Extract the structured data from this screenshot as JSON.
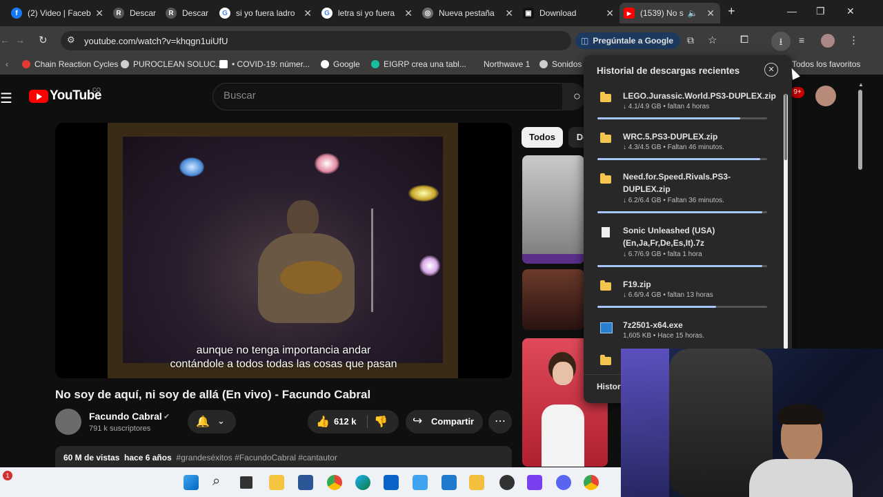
{
  "browser": {
    "tabs": [
      {
        "title": "(2) Video | Faceb",
        "color": "#1877f2",
        "glyph": "f"
      },
      {
        "title": "Descar",
        "color": "#3c3c3c",
        "glyph": "R"
      },
      {
        "title": "Descar",
        "color": "#3c3c3c",
        "glyph": "R"
      },
      {
        "title": "si yo fuera ladro",
        "color": "#ffffff",
        "glyph": "G"
      },
      {
        "title": "letra si yo fuera",
        "color": "#ffffff",
        "glyph": "G"
      },
      {
        "title": "Nueva pestaña",
        "color": "#6e6e6e",
        "glyph": "◎"
      },
      {
        "title": "Download",
        "color": "#2b2b2b",
        "glyph": "▣"
      },
      {
        "title": "(1539) No s",
        "color": "#ff0000",
        "glyph": "▶"
      }
    ],
    "new_tab_glyph": "+",
    "window_controls": [
      "—",
      "❐",
      "✕"
    ],
    "url": "youtube.com/watch?v=khqgn1uiUfU",
    "ask_google": "Pregúntale a Google",
    "bookmarks": [
      {
        "label": "Chain Reaction Cycles",
        "color": "#e53935"
      },
      {
        "label": "PUROCLEAN SOLUC...",
        "color": "#cfcfcf"
      },
      {
        "label": "• COVID-19: númer...",
        "color": "#ffffff"
      },
      {
        "label": "Google",
        "color": "#ffffff"
      },
      {
        "label": "EIGRP crea una tabl...",
        "color": "#1abc9c"
      },
      {
        "label": "Northwave 1",
        "color": "#cfcfcf"
      },
      {
        "label": "Sonidos",
        "color": "#cfcfcf"
      }
    ],
    "all_bookmarks": "Todos los favoritos"
  },
  "youtube": {
    "logo_text": "YouTube",
    "country": "CO",
    "search_placeholder": "Buscar",
    "notif_badge": "9+",
    "subtitle_line1": "aunque no tenga importancia andar",
    "subtitle_line2": "contándole a todos todas las cosas que pasan",
    "video_title": "No soy de aquí, ni soy de allá (En vivo) - Facundo Cabral",
    "channel": "Facundo Cabral",
    "subscribers": "791 k suscriptores",
    "likes": "612 k",
    "share": "Compartir",
    "views": "60 M de vistas",
    "date": "hace 6 años",
    "hashtags": "#grandeséxitos #FacundoCabral #cantautor",
    "chips": [
      "Todos",
      "De"
    ]
  },
  "downloads": {
    "title": "Historial de descargas recientes",
    "footer": "Histor",
    "items": [
      {
        "name": "LEGO.Jurassic.World.PS3-DUPLEX.zip",
        "status": "↓ 4.1/4.9 GB • faltan 4 horas",
        "icon": "folder",
        "progress": 0.84
      },
      {
        "name": "WRC.5.PS3-DUPLEX.zip",
        "status": "↓ 4.3/4.5 GB • Faltan 46 minutos.",
        "icon": "folder",
        "progress": 0.96
      },
      {
        "name": "Need.for.Speed.Rivals.PS3-DUPLEX.zip",
        "status": "↓ 6.2/6.4 GB • Faltan 36 minutos.",
        "icon": "folder",
        "progress": 0.97
      },
      {
        "name": "Sonic Unleashed (USA) (En,Ja,Fr,De,Es,It).7z",
        "status": "↓ 6.7/6.9 GB • falta 1 hora",
        "icon": "file",
        "progress": 0.97
      },
      {
        "name": "F19.zip",
        "status": "↓ 6.6/9.4 GB • faltan 13 horas",
        "icon": "folder",
        "progress": 0.7
      },
      {
        "name": "7z2501-x64.exe",
        "status": "1,605 KB • Hace 15 horas.",
        "icon": "exe",
        "progress": 0
      }
    ]
  },
  "taskbar": {
    "notif_count": "1",
    "icons": [
      "windows-start",
      "search",
      "task-view",
      "file-explorer",
      "store",
      "chrome",
      "edge",
      "outlook",
      "app-blue",
      "vscode",
      "app-yellow",
      "app-red",
      "app-purple",
      "discord",
      "chrome-2"
    ]
  }
}
